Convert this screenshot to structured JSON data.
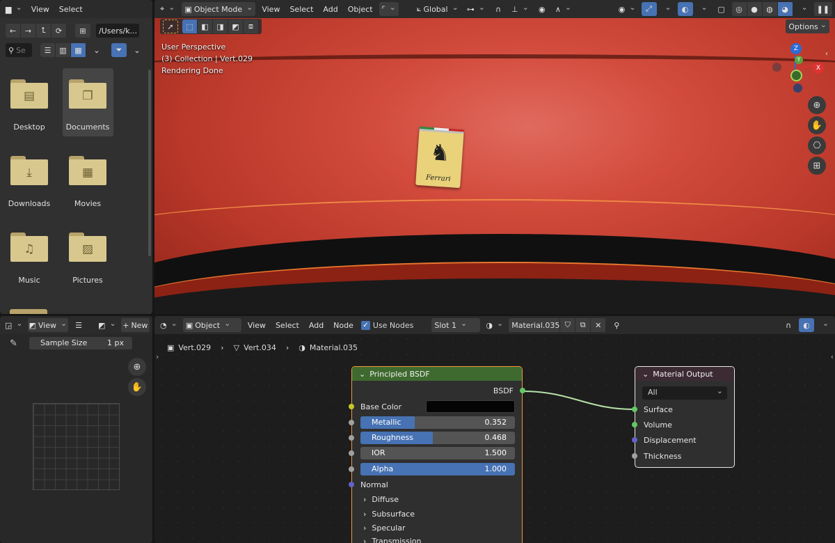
{
  "file_browser": {
    "menus": [
      "View",
      "Select"
    ],
    "path": "/Users/k...",
    "search_placeholder": "Se",
    "folders": [
      {
        "name": "Desktop",
        "glyph": "▤"
      },
      {
        "name": "Documents",
        "glyph": "❐"
      },
      {
        "name": "Downloads",
        "glyph": "⤓"
      },
      {
        "name": "Movies",
        "glyph": "▦"
      },
      {
        "name": "Music",
        "glyph": "♫"
      },
      {
        "name": "Pictures",
        "glyph": "▨"
      }
    ]
  },
  "viewport": {
    "mode": "Object Mode",
    "menus": [
      "View",
      "Select",
      "Add",
      "Object"
    ],
    "transform_orientation": "Global",
    "options_label": "Options",
    "overlay_text": [
      "User Perspective",
      "(3) Collection | Vert.029",
      "Rendering Done"
    ],
    "axes": {
      "z": "Z",
      "y": "Y",
      "x": "X"
    },
    "emblem_text": "Ferrari"
  },
  "image_editor": {
    "view_label": "View",
    "new_label": "New",
    "sample_size_label": "Sample Size",
    "sample_size_value": "1 px"
  },
  "node_editor": {
    "object_label": "Object",
    "menus": [
      "View",
      "Select",
      "Add",
      "Node"
    ],
    "use_nodes_label": "Use Nodes",
    "slot_label": "Slot 1",
    "material_name": "Material.035",
    "breadcrumb": [
      "Vert.029",
      "Vert.034",
      "Material.035"
    ],
    "principled": {
      "title": "Principled BSDF",
      "output_label": "BSDF",
      "base_color_label": "Base Color",
      "fields": [
        {
          "name": "Metallic",
          "value": "0.352",
          "fraction": 0.352
        },
        {
          "name": "Roughness",
          "value": "0.468",
          "fraction": 0.468
        },
        {
          "name": "IOR",
          "value": "1.500",
          "fraction": 0
        },
        {
          "name": "Alpha",
          "value": "1.000",
          "fraction": 1.0
        }
      ],
      "normal_label": "Normal",
      "panels": [
        "Diffuse",
        "Subsurface",
        "Specular",
        "Transmission"
      ]
    },
    "output": {
      "title": "Material Output",
      "target": "All",
      "inputs": [
        "Surface",
        "Volume",
        "Displacement",
        "Thickness"
      ]
    }
  },
  "colors": {
    "accent": "#4772b3",
    "node_header_green": "#3e6a2f",
    "node_header_output": "#3d2b34",
    "shader_socket": "#63c763",
    "color_socket": "#c7c729",
    "vector_socket": "#6363c7",
    "value_socket": "#a1a1a1",
    "car_red": "#c9382a"
  }
}
